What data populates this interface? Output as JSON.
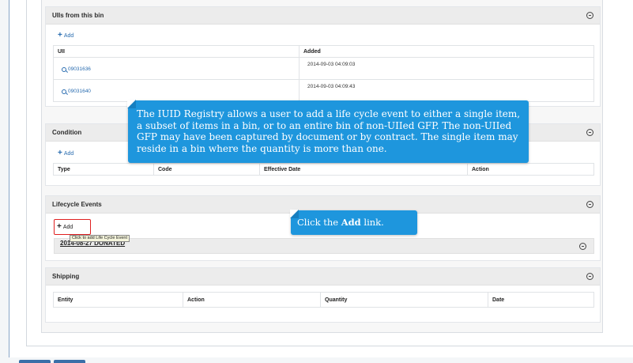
{
  "uiis_panel": {
    "title": "UIIs from this bin",
    "add_label": "Add",
    "columns": [
      "UII",
      "Added"
    ],
    "rows": [
      {
        "uii": "09031636",
        "added": "2014-09-03 04:09:03"
      },
      {
        "uii": "09031640",
        "added": "2014-09-03 04:09:43"
      }
    ]
  },
  "condition_panel": {
    "title": "Condition",
    "add_label": "Add",
    "columns": [
      "Type",
      "Code",
      "Effective Date",
      "Action"
    ]
  },
  "lifecycle_panel": {
    "title": "Lifecycle Events",
    "add_label": "Add",
    "tooltip": "Click to add Life Cycle Event",
    "event_label": "2014-08-27 DONATED"
  },
  "shipping_panel": {
    "title": "Shipping",
    "columns": [
      "Entity",
      "Action",
      "Quantity",
      "Date"
    ]
  },
  "callouts": {
    "intro": "The IUID Registry allows a user to add a life cycle event to either a single item, a subset of items in a bin, or to an entire bin of non-UIIed GFP. The non-UIIed GFP may have been captured by document or by contract. The single item may reside in a bin where the quantity is more than one.",
    "click_prefix": "Click the ",
    "click_bold": "Add",
    "click_suffix": " link."
  },
  "colors": {
    "callout": "#1e96dd",
    "link": "#2a6db0",
    "highlight": "#e02020",
    "panel_header": "#ececec"
  }
}
